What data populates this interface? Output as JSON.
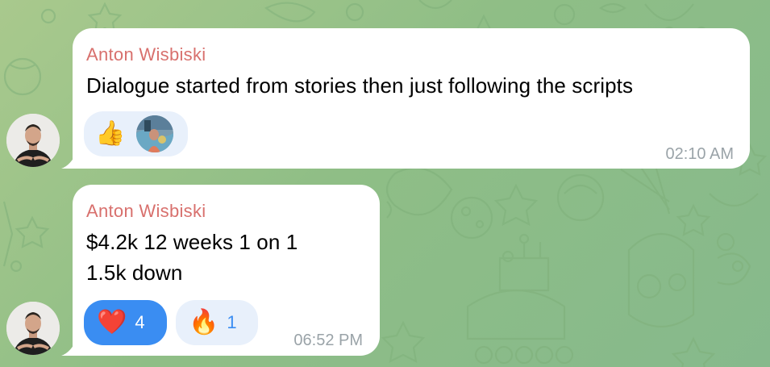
{
  "colors": {
    "background": "#95c087",
    "bubble": "#ffffff",
    "sender": "#d8706d",
    "time": "#9aa3a8",
    "reaction_active": "#3a8df2",
    "reaction_light": "#e8f0fb"
  },
  "messages": [
    {
      "sender": "Anton Wisbiski",
      "lines": [
        "Dialogue started from stories then just following the scripts"
      ],
      "reactions": [
        {
          "emoji": "👍",
          "icon": "thumbs-up-icon",
          "reactor": "reactor-avatar"
        }
      ],
      "time": "02:10 AM"
    },
    {
      "sender": "Anton Wisbiski",
      "lines": [
        "$4.2k 12 weeks 1 on 1",
        "1.5k down"
      ],
      "reactions": [
        {
          "emoji": "❤️",
          "icon": "heart-icon",
          "count": "4",
          "active": true
        },
        {
          "emoji": "🔥",
          "icon": "fire-icon",
          "count": "1",
          "active": false
        }
      ],
      "time": "06:52 PM"
    }
  ]
}
